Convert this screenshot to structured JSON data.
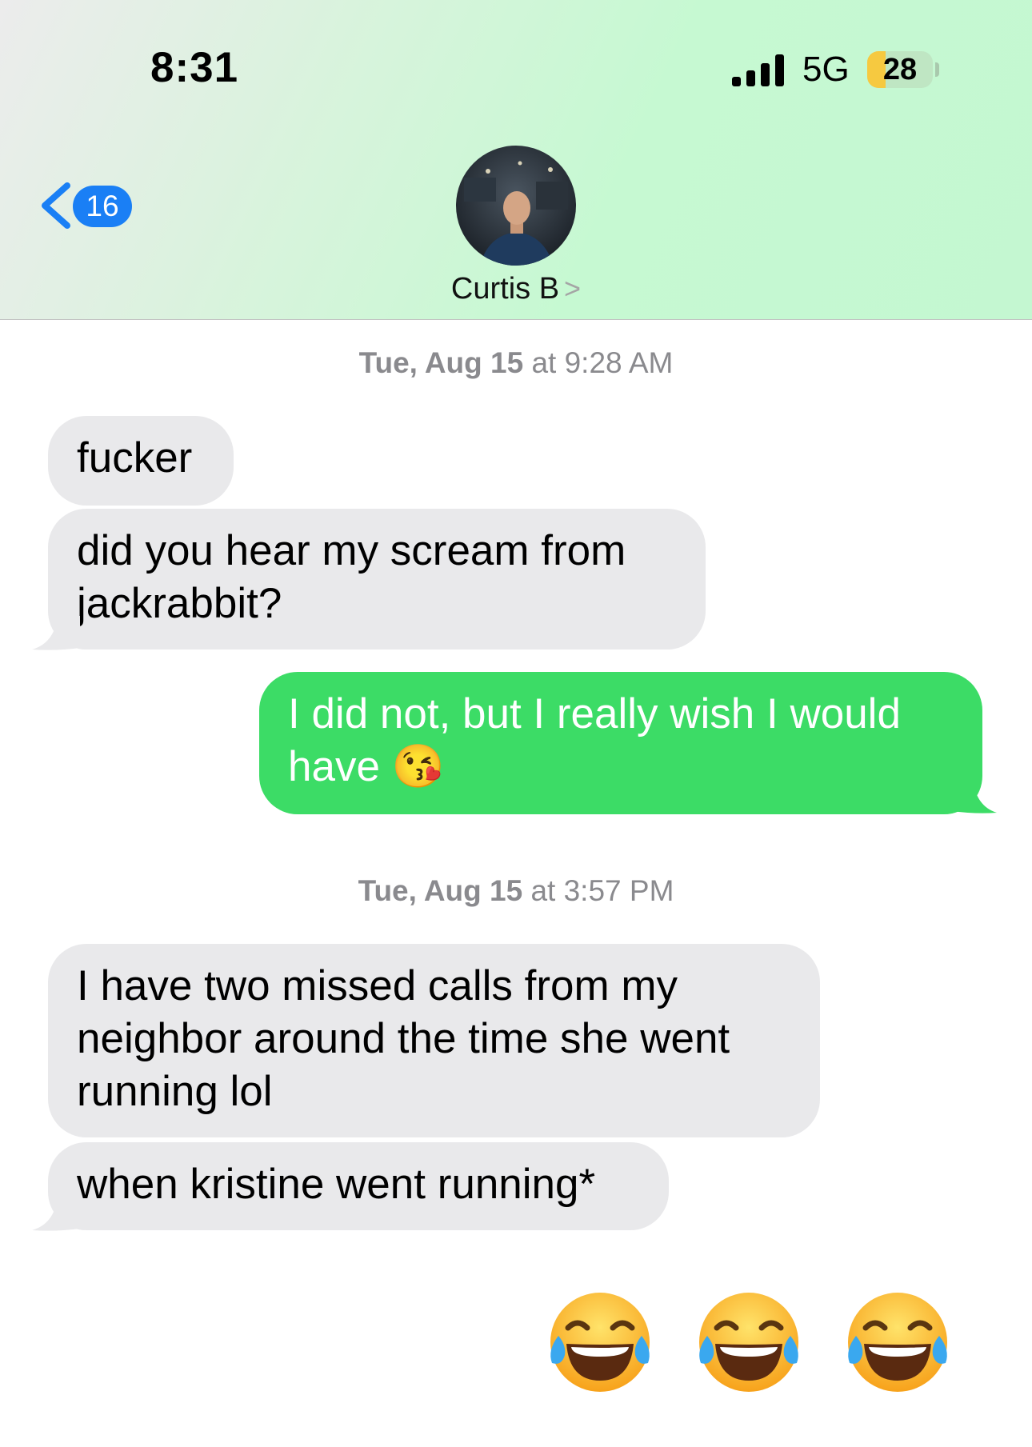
{
  "status_bar": {
    "time": "8:31",
    "network": "5G",
    "battery": "28",
    "battery_level": 0.28
  },
  "header": {
    "back_count": "16",
    "contact_name": "Curtis B",
    "contact_chevron": ">"
  },
  "messages": [
    {
      "type": "timestamp",
      "date": "Tue, Aug 15",
      "at": "at",
      "time": "9:28 AM"
    },
    {
      "type": "incoming",
      "text": "fucker"
    },
    {
      "type": "incoming",
      "lines": [
        "did you hear my scream from",
        "jackrabbit?"
      ]
    },
    {
      "type": "outgoing",
      "lines": [
        "I did not, but I really wish I would",
        "have 😘"
      ]
    },
    {
      "type": "timestamp",
      "date": "Tue, Aug 15",
      "at": "at",
      "time": "3:57 PM"
    },
    {
      "type": "incoming",
      "lines": [
        "I have two missed calls from my",
        "neighbor around the time she went",
        "running lol"
      ]
    },
    {
      "type": "incoming",
      "text": "when kristine went running*"
    }
  ],
  "reactions": [
    "😂",
    "😂",
    "😂"
  ],
  "colors": {
    "incoming_bubble": "#e9e9eb",
    "outgoing_bubble": "#3cdc66",
    "accent_blue": "#1a7ff5"
  },
  "icons": {
    "back": "chevron-left-icon",
    "avatar": "contact-photo",
    "signal": "cellular-signal-icon",
    "battery": "battery-icon"
  }
}
